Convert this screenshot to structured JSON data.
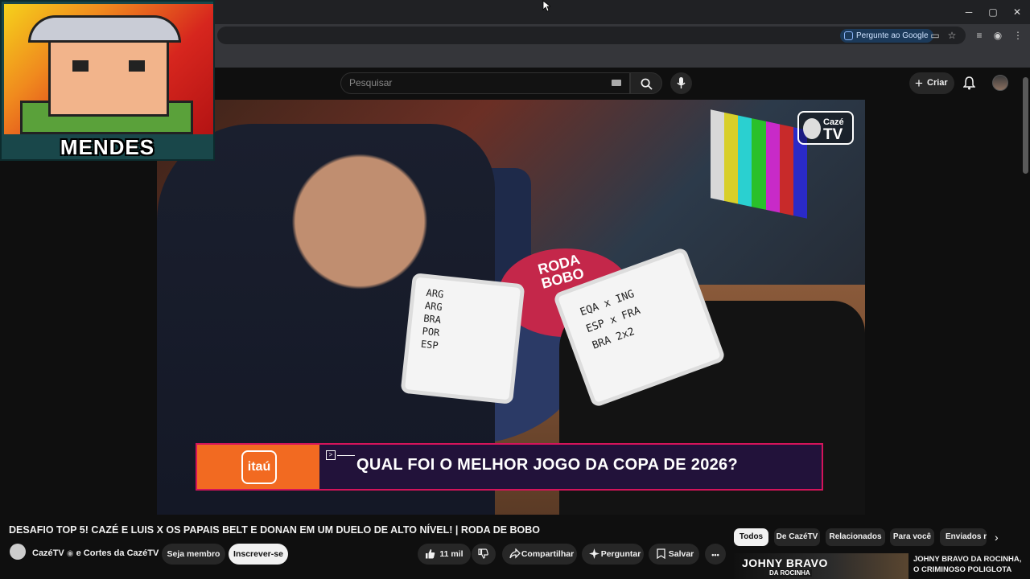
{
  "browser": {
    "ask_google": "Pergunte ao Google",
    "window_controls": [
      "minimize-icon",
      "restore-icon",
      "close-icon"
    ]
  },
  "header": {
    "search_placeholder": "Pesquisar",
    "create_label": "Criar"
  },
  "streamer": {
    "name": "MENDES"
  },
  "video": {
    "channel_logo_line1": "Cazé",
    "channel_logo_line2": "TV",
    "table_logo": "RODA\nBOBO",
    "board1_text": [
      "ARG",
      "ARG",
      "BRA",
      "POR",
      "ESP"
    ],
    "board2_text": [
      "EQA x ING",
      "ESP x FRA",
      "BRA 2x2"
    ],
    "sponsor": "itaú",
    "lower_third": "QUAL FOI O MELHOR JOGO DA COPA DE 2026?",
    "tv_bar_colors": [
      "#d8d8d8",
      "#d8cf2a",
      "#2ad0d0",
      "#2ac02a",
      "#c82ac8",
      "#c82a2a",
      "#2a2ac8"
    ]
  },
  "below": {
    "title": "DESAFIO TOP 5! CAZÉ E LUIS X OS PAPAIS BELT E DONAN EM UM DUELO DE ALTO NÍVEL! | RODA DE BOBO",
    "channel": "CazéTV",
    "channel_suffix": " e Cortes da CazéTV",
    "member_label": "Seja membro",
    "subscribe_label": "Inscrever-se",
    "likes": "11 mil",
    "share_label": "Compartilhar",
    "ask_label": "Perguntar",
    "save_label": "Salvar",
    "more_label": "•••"
  },
  "chips": [
    "Todos",
    "De CazéTV",
    "Relacionados",
    "Para você",
    "Enviados re"
  ],
  "recommended": {
    "thumb_line1": "JOHNY BRAVO",
    "thumb_line2": "DA ROCINHA",
    "title": "JOHNY BRAVO DA ROCINHA, O CRIMINOSO POLIGLOTA"
  }
}
